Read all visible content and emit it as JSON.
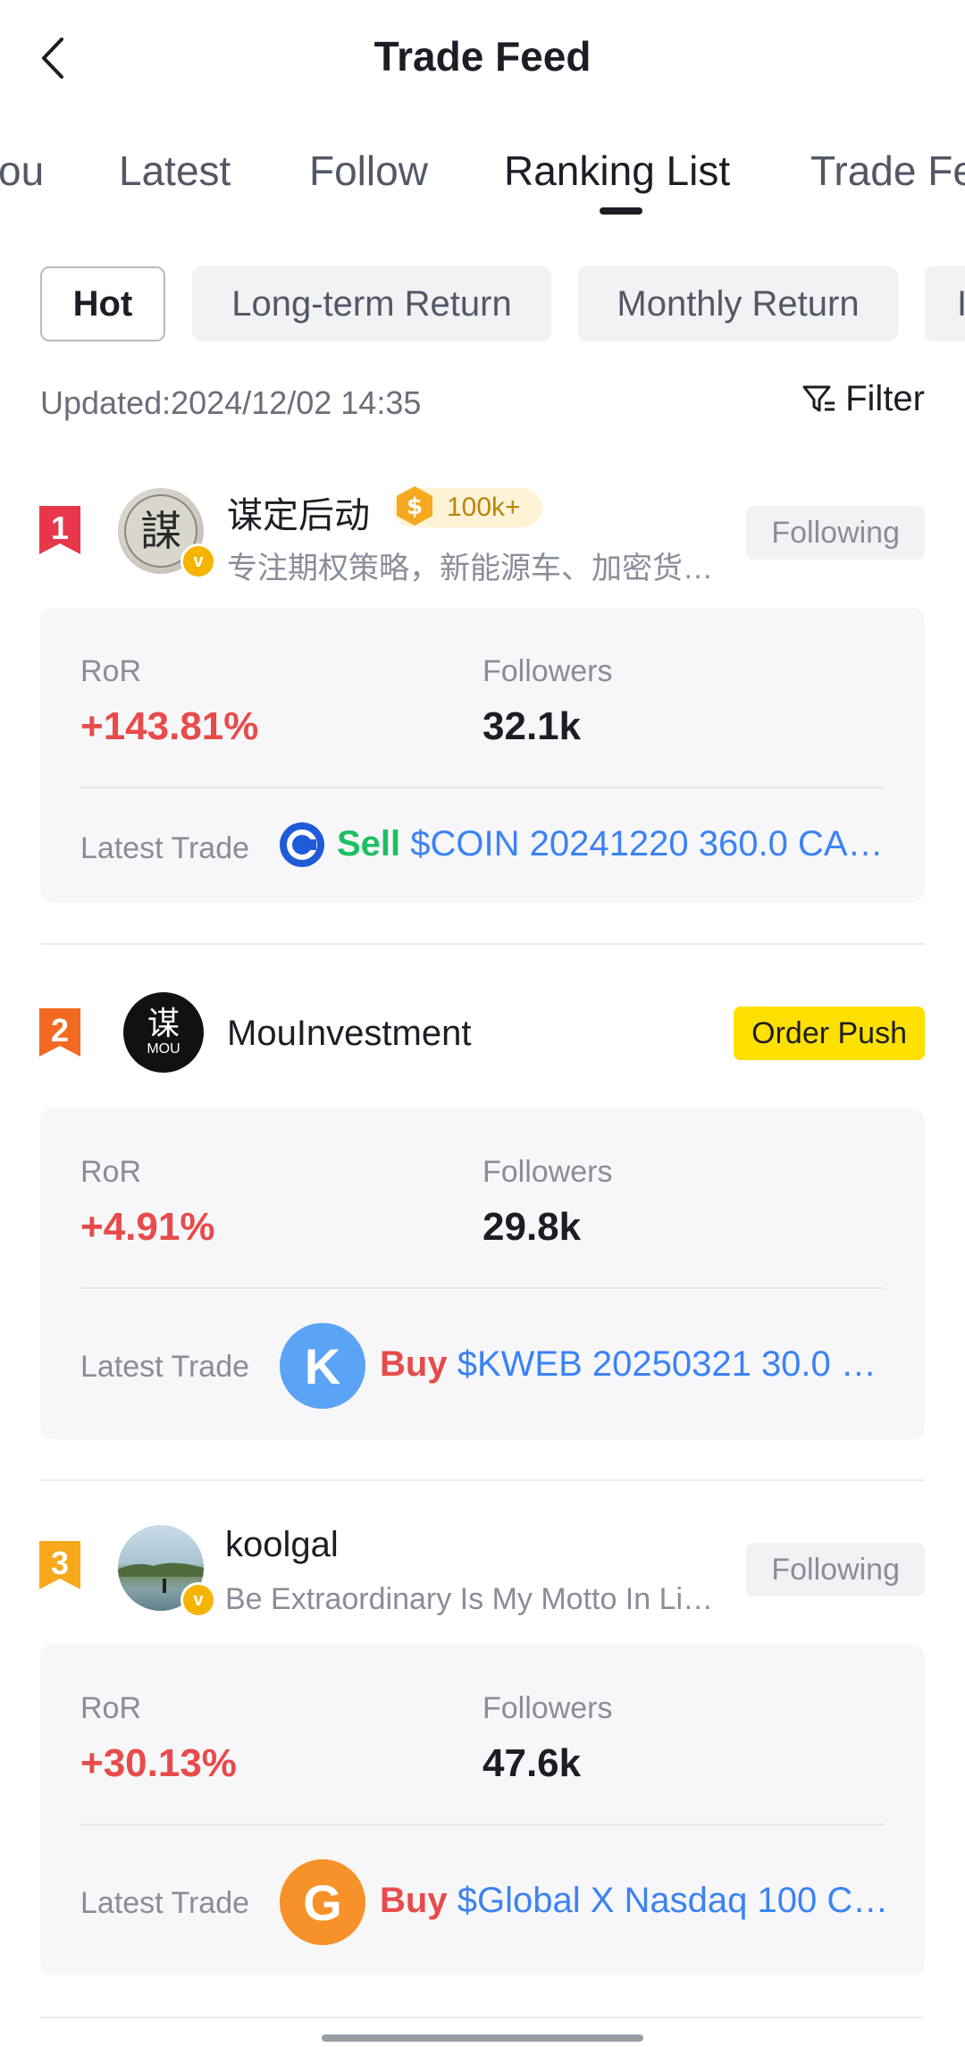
{
  "header": {
    "title": "Trade Feed"
  },
  "tabs": [
    {
      "label": "ou"
    },
    {
      "label": "Latest"
    },
    {
      "label": "Follow"
    },
    {
      "label": "Ranking List",
      "active": true
    },
    {
      "label": "Trade Fe"
    }
  ],
  "filters": [
    {
      "label": "Hot",
      "active": true
    },
    {
      "label": "Long-term Return"
    },
    {
      "label": "Monthly Return"
    },
    {
      "label": "I"
    }
  ],
  "updated": "Updated:2024/12/02 14:35",
  "filter_label": "Filter",
  "entries": [
    {
      "rank": "1",
      "name": "谋定后动",
      "badge": "100k+",
      "bio": "专注期权策略，新能源车、加密货…",
      "action": "Following",
      "ror_label": "RoR",
      "ror": "+143.81%",
      "followers_label": "Followers",
      "followers": "32.1k",
      "trade_label": "Latest Trade",
      "side": "Sell",
      "ticker": "$COIN 20241220 360.0 CA…"
    },
    {
      "rank": "2",
      "name": "MouInvestment",
      "avatar_text": "谋",
      "avatar_sub": "MOU",
      "action": "Order Push",
      "ror_label": "RoR",
      "ror": "+4.91%",
      "followers_label": "Followers",
      "followers": "29.8k",
      "trade_label": "Latest Trade",
      "trade_icon": "K",
      "side": "Buy",
      "ticker": "$KWEB 20250321 30.0 …"
    },
    {
      "rank": "3",
      "name": "koolgal",
      "bio": "Be Extraordinary Is My Motto In Li…",
      "action": "Following",
      "ror_label": "RoR",
      "ror": "+30.13%",
      "followers_label": "Followers",
      "followers": "47.6k",
      "trade_label": "Latest Trade",
      "trade_icon": "G",
      "side": "Buy",
      "ticker": "$Global X Nasdaq 100 C…"
    }
  ],
  "colors": {
    "rank1": "#e8364a",
    "rank2": "#f26a22",
    "rank3": "#f7a81b",
    "positive": "#e84b4b",
    "sell": "#1fbf63",
    "ticker": "#3b82f6",
    "order_push": "#ffe000"
  }
}
